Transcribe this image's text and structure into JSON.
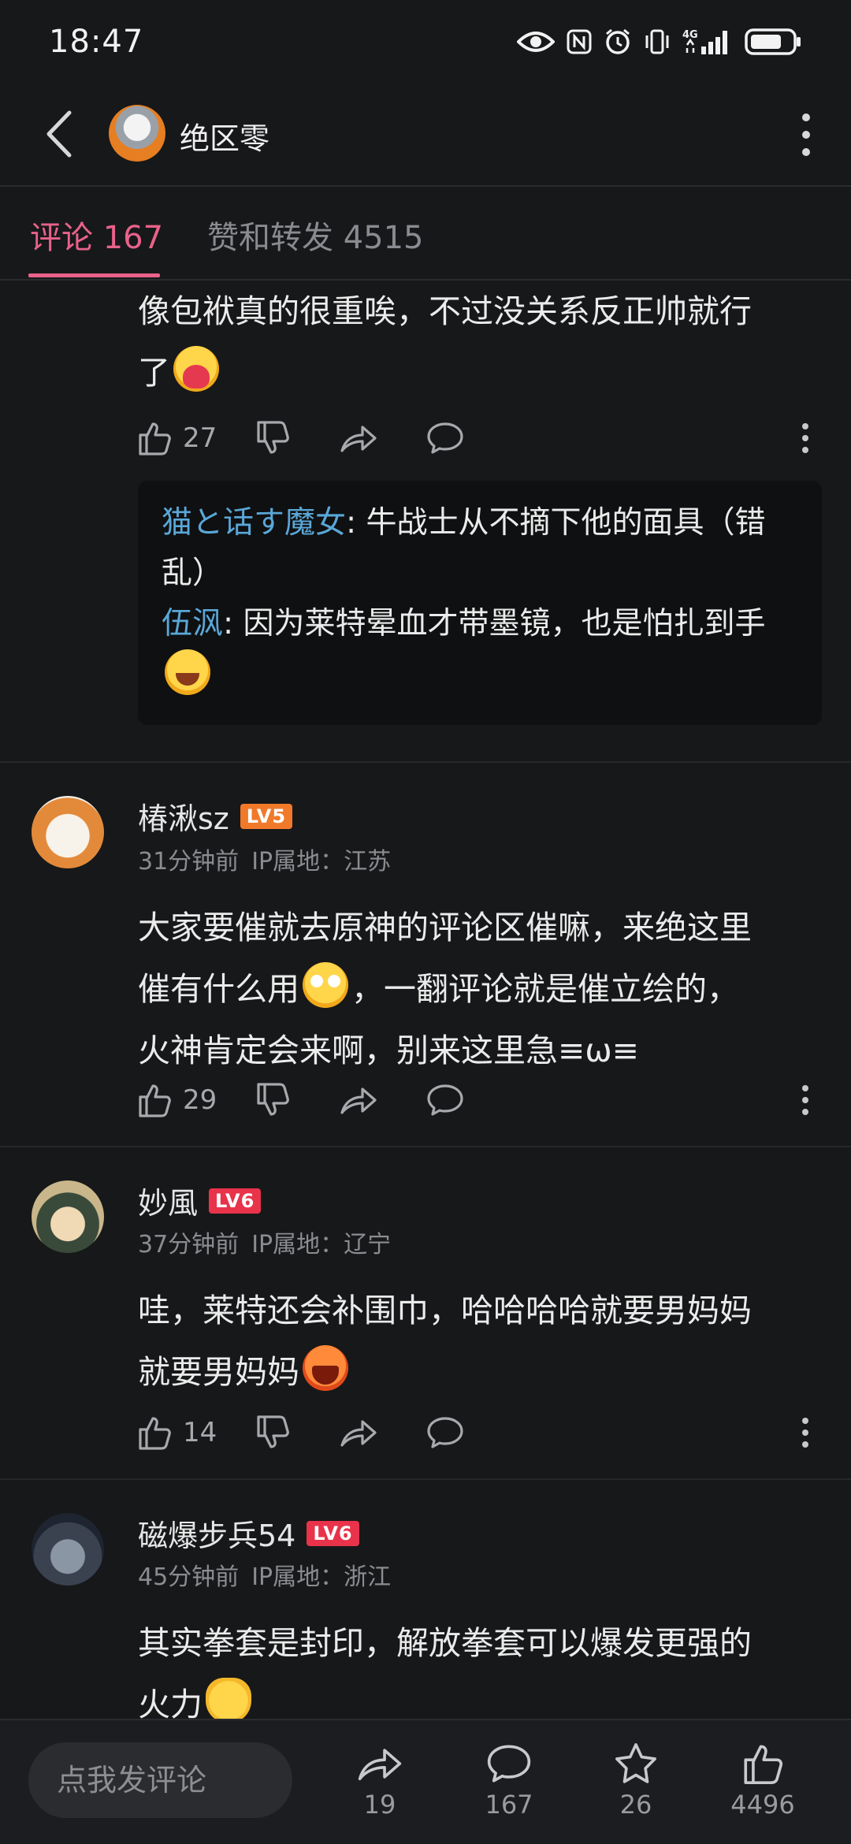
{
  "status_bar": {
    "time": "18:47",
    "network": "4G"
  },
  "header": {
    "title": "绝区零"
  },
  "tabs": {
    "comments": "评论 167",
    "likes_reposts": "赞和转发 4515"
  },
  "comments": [
    {
      "text_line1": "像包袱真的很重唉，不过没关系反正帅就行",
      "text_line2": "了",
      "likes": "27",
      "replies": [
        {
          "name": "猫と话す魔女",
          "text": ": 牛战士从不摘下他的面具（错乱）"
        },
        {
          "name": "伍沨",
          "text": ": 因为莱特晕血才带墨镜，也是怕扎到手"
        }
      ]
    },
    {
      "username": "椿湫sz",
      "level": "LV5",
      "time": "31分钟前",
      "ip": "IP属地：江苏",
      "text_line1": "大家要催就去原神的评论区催嘛，来绝这里",
      "text_line2a": "催有什么用",
      "text_line2b": "，一翻评论就是催立绘的，",
      "text_line3": "火神肯定会来啊，别来这里急≡ω≡",
      "likes": "29"
    },
    {
      "username": "妙風",
      "level": "LV6",
      "time": "37分钟前",
      "ip": "IP属地：辽宁",
      "text_line1": "哇，莱特还会补围巾，哈哈哈哈就要男妈妈",
      "text_line2": "就要男妈妈",
      "likes": "14"
    },
    {
      "username": "磁爆步兵54",
      "level": "LV6",
      "time": "45分钟前",
      "ip": "IP属地：浙江",
      "text_line1": "其实拳套是封印，解放拳套可以爆发更强的",
      "text_line2": "火力"
    }
  ],
  "bottom_bar": {
    "input_placeholder": "点我发评论",
    "share_count": "19",
    "comment_count": "167",
    "favorite_count": "26",
    "like_count": "4496"
  },
  "colors": {
    "accent": "#e8628a",
    "reply_name": "#5aa7d8",
    "background": "#17181a"
  }
}
